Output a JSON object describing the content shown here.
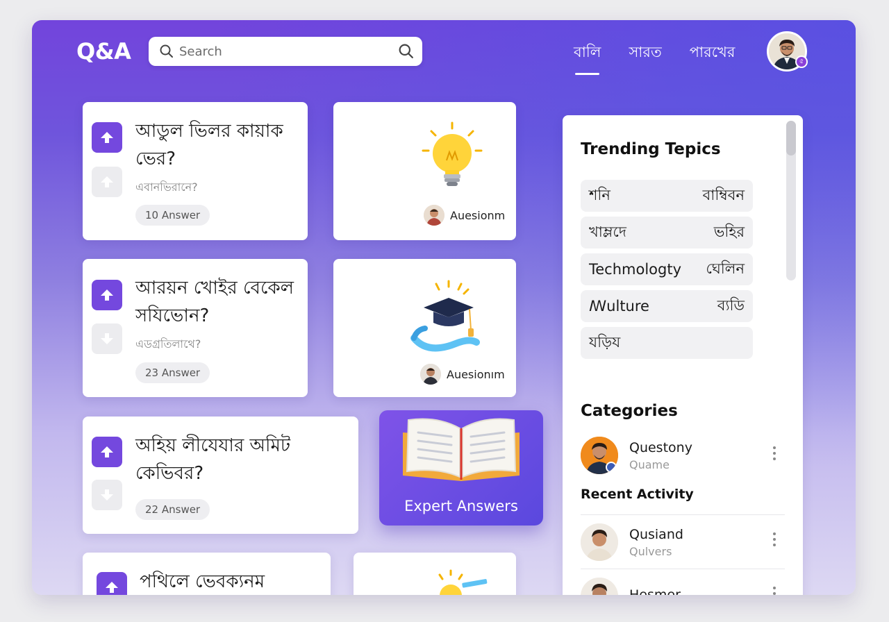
{
  "header": {
    "logo": "Q&A",
    "search_placeholder": "Search",
    "nav": [
      "বালি",
      "সারত",
      "পারখের"
    ]
  },
  "questions": [
    {
      "title": "আডুল ভিলর কায়াক ভের?",
      "subtitle": "এবানভিরানে?",
      "answers": "10 Answer"
    },
    {
      "title": "আরয়ন খোইর বেকেল সযিভোন?",
      "subtitle": "এডগ্রতিলাথে?",
      "answers": "23 Answer"
    },
    {
      "title": "অহিয় লীযেযার অমিট কেভিবর?",
      "answers": "22 Answer"
    },
    {
      "title": "পথিলে ভেবক্যনম"
    }
  ],
  "image_cards": [
    {
      "icon": "lightbulb-icon",
      "author": "Auesionm"
    },
    {
      "icon": "graduation-cap-icon",
      "author": "Auesionım"
    }
  ],
  "expert": {
    "label": "Expert Answers",
    "icon": "open-book-icon"
  },
  "sidebar": {
    "trending_title": "Trending Tepics",
    "topics": [
      {
        "left": "শনি",
        "right": "বাম্বিবন"
      },
      {
        "left": "খাম্লদে",
        "right": "ভহির"
      },
      {
        "left": "Techmologty",
        "right": "ঘেলিন"
      },
      {
        "left": "ꟿulture",
        "right": "ব্যডি"
      },
      {
        "left": "যড়িয",
        "right": ""
      }
    ],
    "categories_title": "Categories",
    "category_person": {
      "name": "Questony",
      "sub": "Quame"
    },
    "recent_title": "Recent Activity",
    "recent": [
      {
        "name": "Qusiand",
        "sub": "Qulvers"
      },
      {
        "name": "Hesmer",
        "sub": ""
      }
    ]
  },
  "colors": {
    "accent": "#7448de",
    "header_gradient_start": "#7244dc"
  }
}
